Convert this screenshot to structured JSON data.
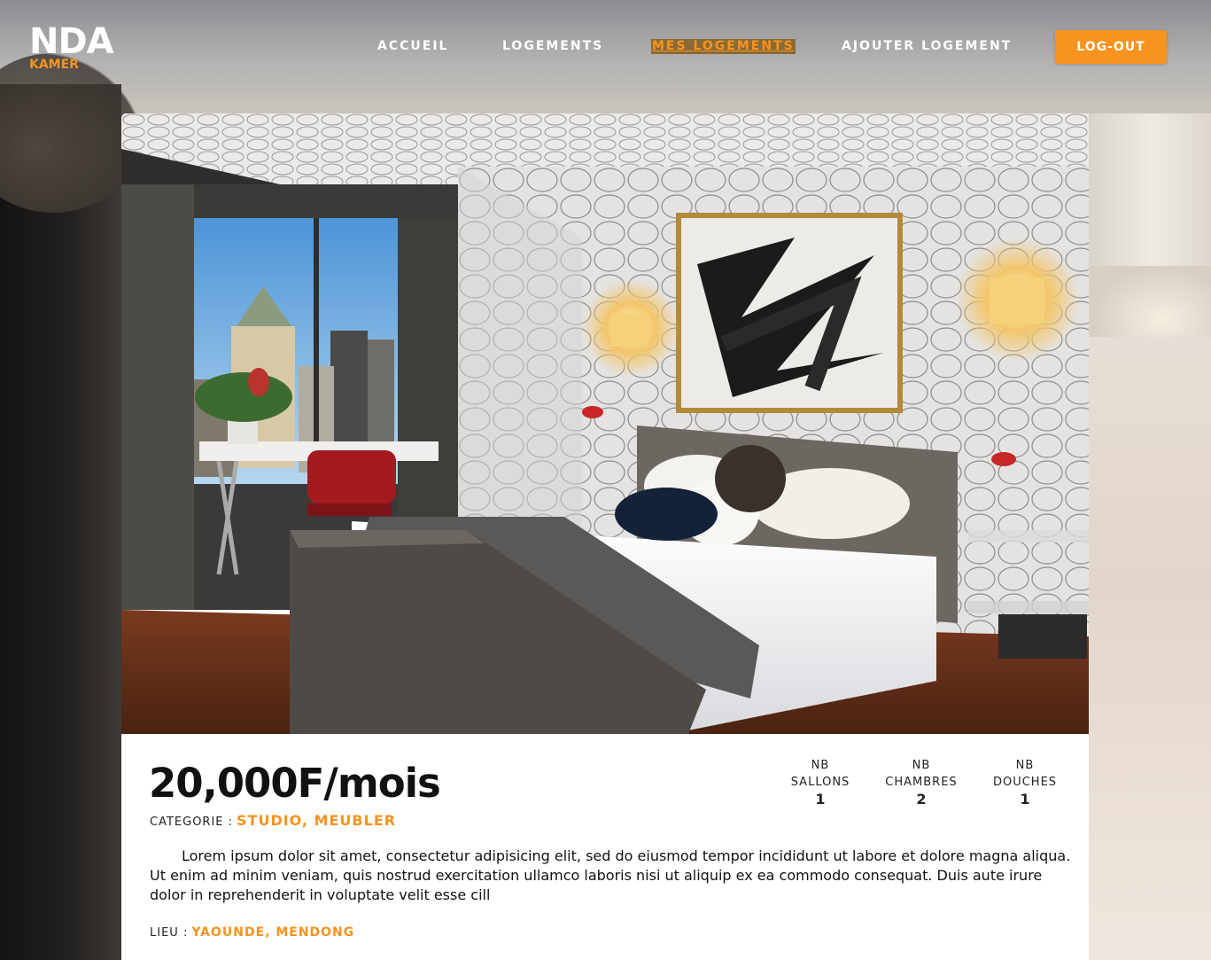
{
  "brand": {
    "name": "NDA",
    "sub": "KAMER"
  },
  "nav": {
    "items": [
      {
        "label": "ACCUEIL"
      },
      {
        "label": "LOGEMENTS"
      },
      {
        "label": "MES LOGEMENTS",
        "active": true
      },
      {
        "label": "AJOUTER LOGEMENT"
      }
    ],
    "logout_label": "LOG-OUT"
  },
  "listing": {
    "photo_icon": "bedroom-photo",
    "price": "20,000F/mois",
    "category_label": "CATEGORIE :",
    "category_value": "STUDIO, MEUBLER",
    "stats": [
      {
        "title_line1": "NB",
        "title_line2": "SALLONS",
        "value": "1"
      },
      {
        "title_line1": "NB",
        "title_line2": "CHAMBRES",
        "value": "2"
      },
      {
        "title_line1": "NB",
        "title_line2": "DOUCHES",
        "value": "1"
      }
    ],
    "description": "Lorem ipsum dolor sit amet, consectetur adipisicing elit, sed do eiusmod tempor incididunt ut labore et dolore magna aliqua. Ut enim ad minim veniam, quis nostrud exercitation ullamco laboris nisi ut aliquip ex ea commodo consequat. Duis aute irure dolor in reprehenderit in voluptate velit esse cill",
    "location_label": "LIEU :",
    "location_value": "YAOUNDE, MENDONG"
  },
  "colors": {
    "accent": "#f7931e",
    "text": "#111111",
    "card_bg": "#ffffff"
  }
}
